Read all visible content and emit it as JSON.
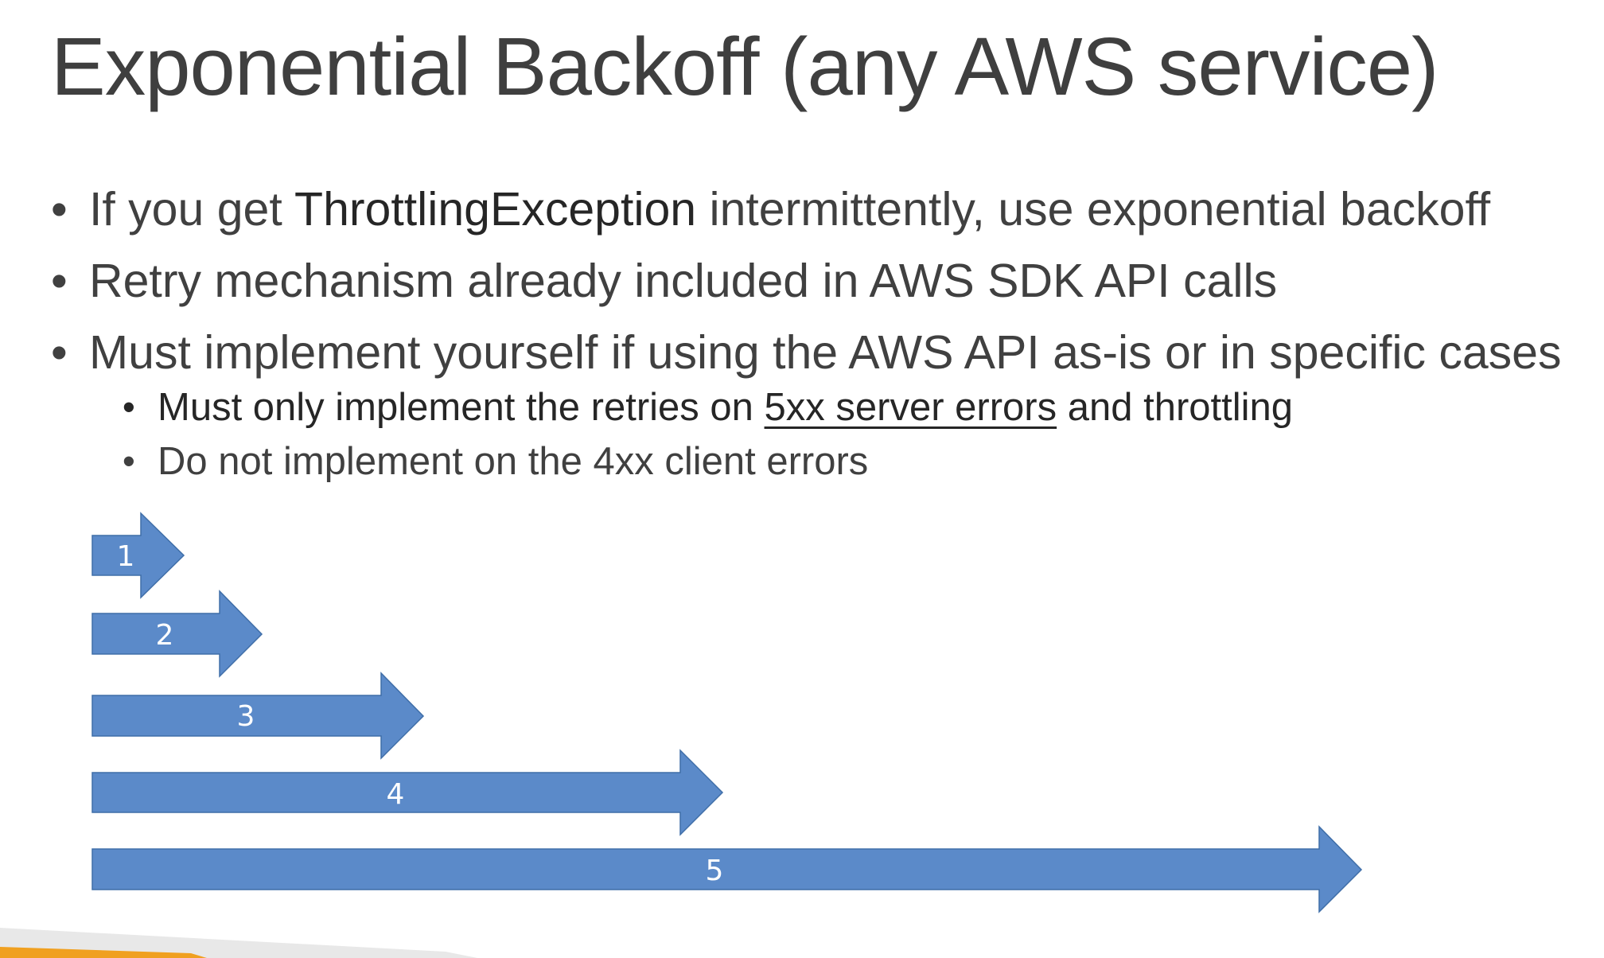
{
  "slide": {
    "title": "Exponential Backoff (any AWS service)",
    "bullets": [
      {
        "prefix": "If you get ",
        "emphasis": "ThrottlingException",
        "suffix": " intermittently, use exponential backoff"
      },
      {
        "text": "Retry mechanism already included in AWS SDK API calls"
      },
      {
        "text": "Must implement yourself if using the AWS API as-is or in specific cases",
        "sub_bullets": [
          {
            "prefix": "Must only implement the retries on ",
            "underlined": "5xx server errors",
            "suffix": " and throttling"
          },
          {
            "text": "Do not implement on the 4xx client errors"
          }
        ]
      }
    ]
  },
  "arrows": {
    "labels": [
      "1",
      "2",
      "3",
      "4",
      "5"
    ],
    "fill_color": "#5b8ac9",
    "stroke_color": "#3f6ea8"
  },
  "footer": {
    "band_color": "#e8e8e8",
    "accent_color": "#f0a020"
  }
}
